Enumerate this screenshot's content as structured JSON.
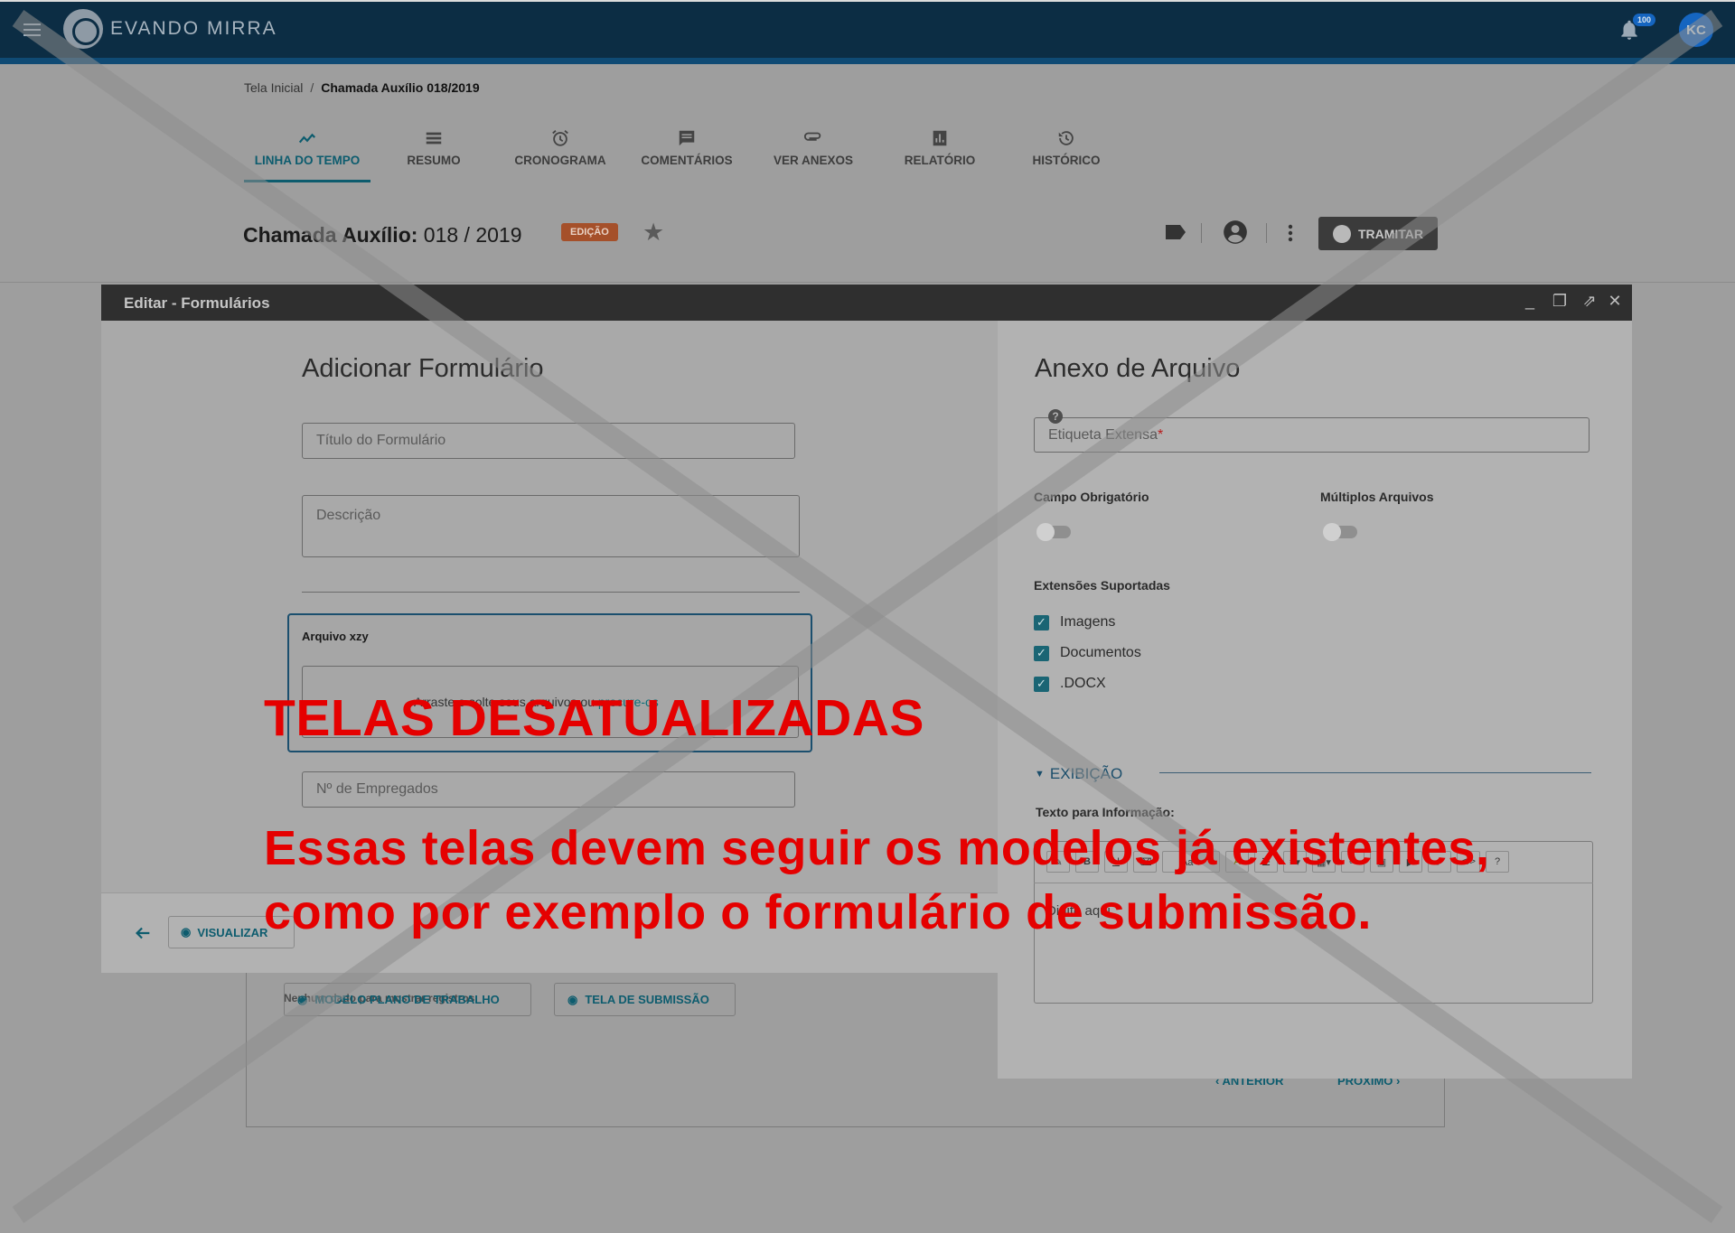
{
  "appbar": {
    "brand": "EVANDO MIRRA",
    "notification_count": "100",
    "avatar_initials": "KC"
  },
  "breadcrumb": {
    "home": "Tela Inicial",
    "separator": "/",
    "current": "Chamada Auxílio 018/2019"
  },
  "tabs": [
    {
      "label": "LINHA DO TEMPO",
      "icon": "timeline-icon",
      "active": true
    },
    {
      "label": "RESUMO",
      "icon": "list-icon",
      "active": false
    },
    {
      "label": "CRONOGRAMA",
      "icon": "alarm-icon",
      "active": false
    },
    {
      "label": "COMENTÁRIOS",
      "icon": "comment-icon",
      "active": false
    },
    {
      "label": "VER ANEXOS",
      "icon": "attachment-icon",
      "active": false
    },
    {
      "label": "RELATÓRIO",
      "icon": "report-icon",
      "active": false
    },
    {
      "label": "HISTÓRICO",
      "icon": "history-icon",
      "active": false
    }
  ],
  "header": {
    "title_bold": "Chamada Auxílio:",
    "title_value": "018 / 2019",
    "status_badge": "EDIÇÃO",
    "tramitar_label": "TRAMITAR"
  },
  "dialog": {
    "title": "Editar - Formulários",
    "left": {
      "heading": "Adicionar Formulário",
      "title_placeholder": "Título do Formulário",
      "description_placeholder": "Descrição",
      "upload_label": "Arquivo xzy",
      "dropzone_text": "Arraste e solte seus arquivos ou ",
      "dropzone_link": "procure-os",
      "employees_placeholder": "Nº de Empregados",
      "visualizar_label": "VISUALIZAR"
    },
    "right": {
      "heading": "Anexo de Arquivo",
      "label_field": "Etiqueta Extensa",
      "required_mark": "*",
      "campo_obrigatorio": "Campo Obrigatório",
      "multiplos_arquivos": "Múltiplos Arquivos",
      "extensoes_label": "Extensões Suportadas",
      "extensions": [
        "Imagens",
        "Documentos",
        ".DOCX"
      ],
      "section_title": "EXIBIÇÃO",
      "texto_info_label": "Texto para Informação:",
      "editor_placeholder": "Digite aqui"
    }
  },
  "background": {
    "caption": "Nenhum dado para mostrar registros",
    "btn_modelo": "MODELO PLANO DE TRABALHO",
    "btn_submissao": "TELA DE SUBMISSÃO",
    "anterior": "ANTERIOR",
    "proximo": "PRÓXIMO"
  },
  "watermark": {
    "title": "TELAS DESATUALIZADAS",
    "message": "Essas telas devem seguir os modelos já existentes, como por exemplo o formulário de submissão."
  },
  "colors": {
    "appbar": "#0c2d44",
    "accent": "#0d5c6e",
    "badge": "#a5502a",
    "watermark": "#e50000"
  }
}
